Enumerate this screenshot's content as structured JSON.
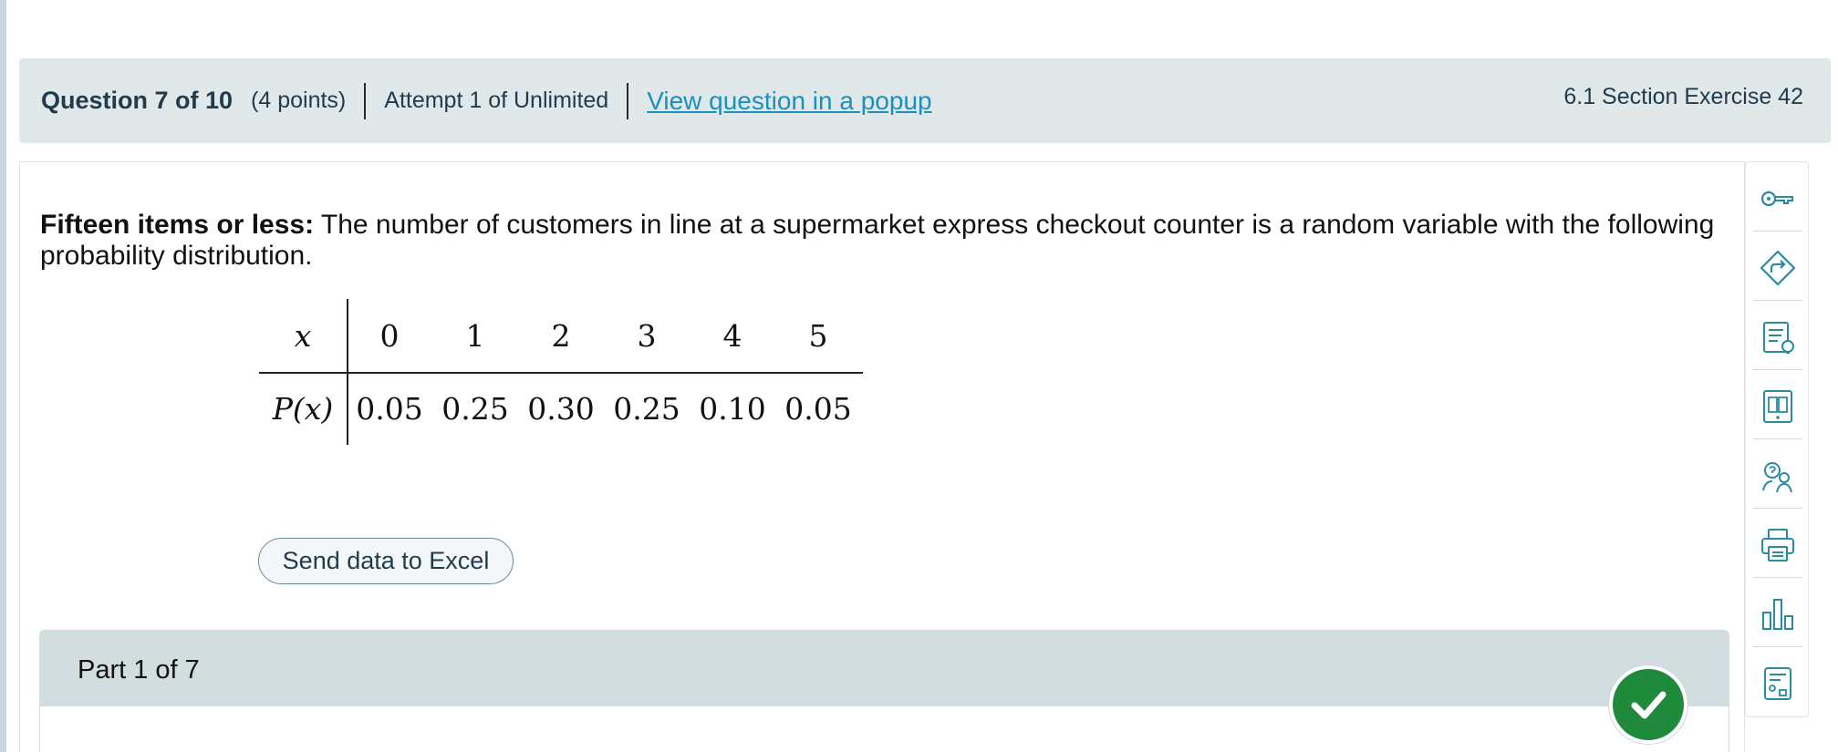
{
  "header": {
    "question": "Question 7 of 10",
    "points": "(4 points)",
    "attempt": "Attempt 1 of Unlimited",
    "popup_link": "View question in a popup",
    "section": "6.1 Section Exercise 42"
  },
  "prompt": {
    "title": "Fifteen items or less:",
    "text": " The number of customers in line at a supermarket express checkout counter is a random variable with the following probability distribution."
  },
  "table": {
    "x_label": "x",
    "px_label": "P(x)",
    "x_values": [
      "0",
      "1",
      "2",
      "3",
      "4",
      "5"
    ],
    "p_values": [
      "0.05",
      "0.25",
      "0.30",
      "0.25",
      "0.10",
      "0.05"
    ]
  },
  "excel_button": "Send data to Excel",
  "part": {
    "label": "Part 1 of 7"
  },
  "toolbar": {
    "icons": [
      "key-icon",
      "navigate-icon",
      "hint-icon",
      "ebook-icon",
      "ask-instructor-icon",
      "print-icon",
      "chart-icon",
      "calculator-icon"
    ]
  },
  "colors": {
    "header_bg": "#e0e8ea",
    "link": "#1a8fc0",
    "accent": "#2a8aa0",
    "check": "#1f8a3b",
    "part_bg": "#d2dde0"
  }
}
